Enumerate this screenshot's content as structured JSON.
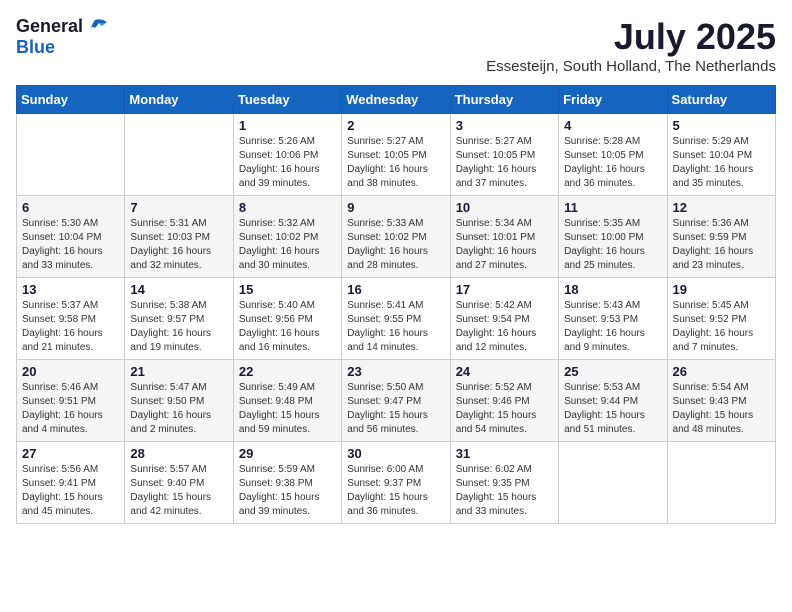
{
  "logo": {
    "general": "General",
    "blue": "Blue"
  },
  "title": "July 2025",
  "location": "Essesteijn, South Holland, The Netherlands",
  "weekdays": [
    "Sunday",
    "Monday",
    "Tuesday",
    "Wednesday",
    "Thursday",
    "Friday",
    "Saturday"
  ],
  "weeks": [
    [
      {
        "day": "",
        "info": ""
      },
      {
        "day": "",
        "info": ""
      },
      {
        "day": "1",
        "info": "Sunrise: 5:26 AM\nSunset: 10:06 PM\nDaylight: 16 hours\nand 39 minutes."
      },
      {
        "day": "2",
        "info": "Sunrise: 5:27 AM\nSunset: 10:05 PM\nDaylight: 16 hours\nand 38 minutes."
      },
      {
        "day": "3",
        "info": "Sunrise: 5:27 AM\nSunset: 10:05 PM\nDaylight: 16 hours\nand 37 minutes."
      },
      {
        "day": "4",
        "info": "Sunrise: 5:28 AM\nSunset: 10:05 PM\nDaylight: 16 hours\nand 36 minutes."
      },
      {
        "day": "5",
        "info": "Sunrise: 5:29 AM\nSunset: 10:04 PM\nDaylight: 16 hours\nand 35 minutes."
      }
    ],
    [
      {
        "day": "6",
        "info": "Sunrise: 5:30 AM\nSunset: 10:04 PM\nDaylight: 16 hours\nand 33 minutes."
      },
      {
        "day": "7",
        "info": "Sunrise: 5:31 AM\nSunset: 10:03 PM\nDaylight: 16 hours\nand 32 minutes."
      },
      {
        "day": "8",
        "info": "Sunrise: 5:32 AM\nSunset: 10:02 PM\nDaylight: 16 hours\nand 30 minutes."
      },
      {
        "day": "9",
        "info": "Sunrise: 5:33 AM\nSunset: 10:02 PM\nDaylight: 16 hours\nand 28 minutes."
      },
      {
        "day": "10",
        "info": "Sunrise: 5:34 AM\nSunset: 10:01 PM\nDaylight: 16 hours\nand 27 minutes."
      },
      {
        "day": "11",
        "info": "Sunrise: 5:35 AM\nSunset: 10:00 PM\nDaylight: 16 hours\nand 25 minutes."
      },
      {
        "day": "12",
        "info": "Sunrise: 5:36 AM\nSunset: 9:59 PM\nDaylight: 16 hours\nand 23 minutes."
      }
    ],
    [
      {
        "day": "13",
        "info": "Sunrise: 5:37 AM\nSunset: 9:58 PM\nDaylight: 16 hours\nand 21 minutes."
      },
      {
        "day": "14",
        "info": "Sunrise: 5:38 AM\nSunset: 9:57 PM\nDaylight: 16 hours\nand 19 minutes."
      },
      {
        "day": "15",
        "info": "Sunrise: 5:40 AM\nSunset: 9:56 PM\nDaylight: 16 hours\nand 16 minutes."
      },
      {
        "day": "16",
        "info": "Sunrise: 5:41 AM\nSunset: 9:55 PM\nDaylight: 16 hours\nand 14 minutes."
      },
      {
        "day": "17",
        "info": "Sunrise: 5:42 AM\nSunset: 9:54 PM\nDaylight: 16 hours\nand 12 minutes."
      },
      {
        "day": "18",
        "info": "Sunrise: 5:43 AM\nSunset: 9:53 PM\nDaylight: 16 hours\nand 9 minutes."
      },
      {
        "day": "19",
        "info": "Sunrise: 5:45 AM\nSunset: 9:52 PM\nDaylight: 16 hours\nand 7 minutes."
      }
    ],
    [
      {
        "day": "20",
        "info": "Sunrise: 5:46 AM\nSunset: 9:51 PM\nDaylight: 16 hours\nand 4 minutes."
      },
      {
        "day": "21",
        "info": "Sunrise: 5:47 AM\nSunset: 9:50 PM\nDaylight: 16 hours\nand 2 minutes."
      },
      {
        "day": "22",
        "info": "Sunrise: 5:49 AM\nSunset: 9:48 PM\nDaylight: 15 hours\nand 59 minutes."
      },
      {
        "day": "23",
        "info": "Sunrise: 5:50 AM\nSunset: 9:47 PM\nDaylight: 15 hours\nand 56 minutes."
      },
      {
        "day": "24",
        "info": "Sunrise: 5:52 AM\nSunset: 9:46 PM\nDaylight: 15 hours\nand 54 minutes."
      },
      {
        "day": "25",
        "info": "Sunrise: 5:53 AM\nSunset: 9:44 PM\nDaylight: 15 hours\nand 51 minutes."
      },
      {
        "day": "26",
        "info": "Sunrise: 5:54 AM\nSunset: 9:43 PM\nDaylight: 15 hours\nand 48 minutes."
      }
    ],
    [
      {
        "day": "27",
        "info": "Sunrise: 5:56 AM\nSunset: 9:41 PM\nDaylight: 15 hours\nand 45 minutes."
      },
      {
        "day": "28",
        "info": "Sunrise: 5:57 AM\nSunset: 9:40 PM\nDaylight: 15 hours\nand 42 minutes."
      },
      {
        "day": "29",
        "info": "Sunrise: 5:59 AM\nSunset: 9:38 PM\nDaylight: 15 hours\nand 39 minutes."
      },
      {
        "day": "30",
        "info": "Sunrise: 6:00 AM\nSunset: 9:37 PM\nDaylight: 15 hours\nand 36 minutes."
      },
      {
        "day": "31",
        "info": "Sunrise: 6:02 AM\nSunset: 9:35 PM\nDaylight: 15 hours\nand 33 minutes."
      },
      {
        "day": "",
        "info": ""
      },
      {
        "day": "",
        "info": ""
      }
    ]
  ]
}
